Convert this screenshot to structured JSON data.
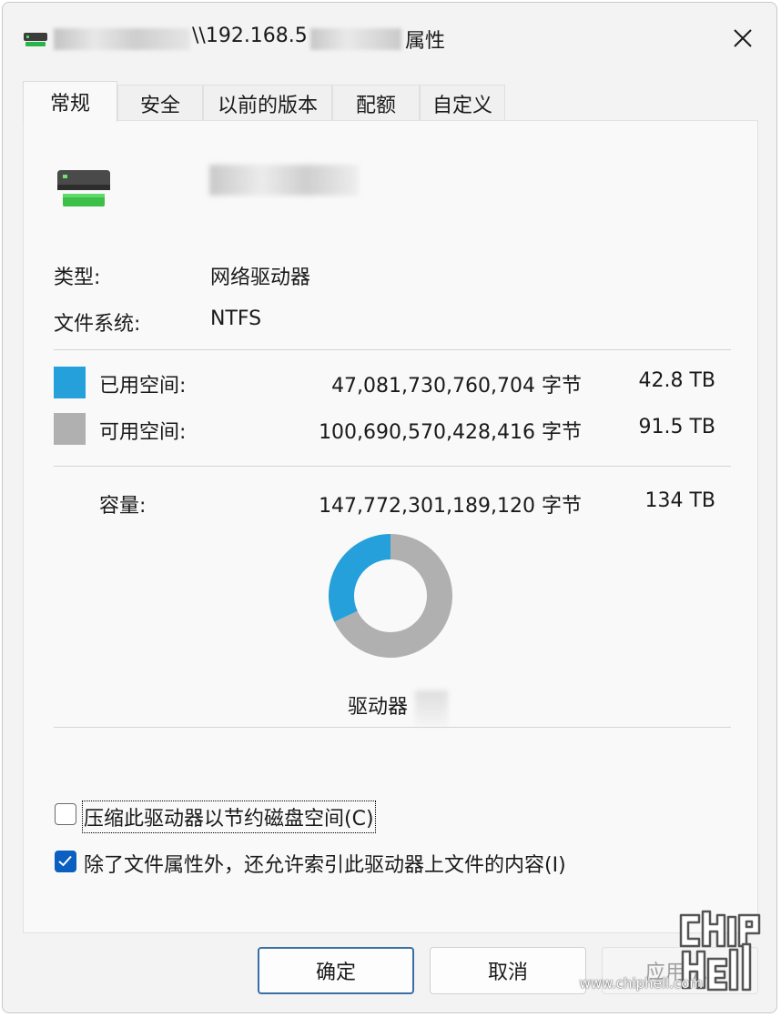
{
  "window": {
    "title_path": "\\\\192.168.5",
    "title_suffix": "属性"
  },
  "tabs": [
    {
      "label": "常规",
      "active": true
    },
    {
      "label": "安全",
      "active": false
    },
    {
      "label": "以前的版本",
      "active": false
    },
    {
      "label": "配额",
      "active": false
    },
    {
      "label": "自定义",
      "active": false
    }
  ],
  "general": {
    "type_label": "类型:",
    "type_value": "网络驱动器",
    "fs_label": "文件系统:",
    "fs_value": "NTFS",
    "used": {
      "label": "已用空间:",
      "bytes": "47,081,730,760,704 字节",
      "size": "42.8 TB",
      "color": "#26a0da"
    },
    "free": {
      "label": "可用空间:",
      "bytes": "100,690,570,428,416 字节",
      "size": "91.5 TB",
      "color": "#b0b0b0"
    },
    "capacity": {
      "label": "容量:",
      "bytes": "147,772,301,189,120 字节",
      "size": "134 TB"
    },
    "used_fraction": 0.319,
    "drive_label": "驱动器"
  },
  "options": {
    "compress": {
      "label": "压缩此驱动器以节约磁盘空间(C)",
      "checked": false
    },
    "index": {
      "label": "除了文件属性外，还允许索引此驱动器上文件的内容(I)",
      "checked": true
    }
  },
  "buttons": {
    "ok": "确定",
    "cancel": "取消",
    "apply": "应用(A)"
  },
  "watermark": {
    "url": "www.chiphell.com",
    "logo_text": "chip hell"
  }
}
